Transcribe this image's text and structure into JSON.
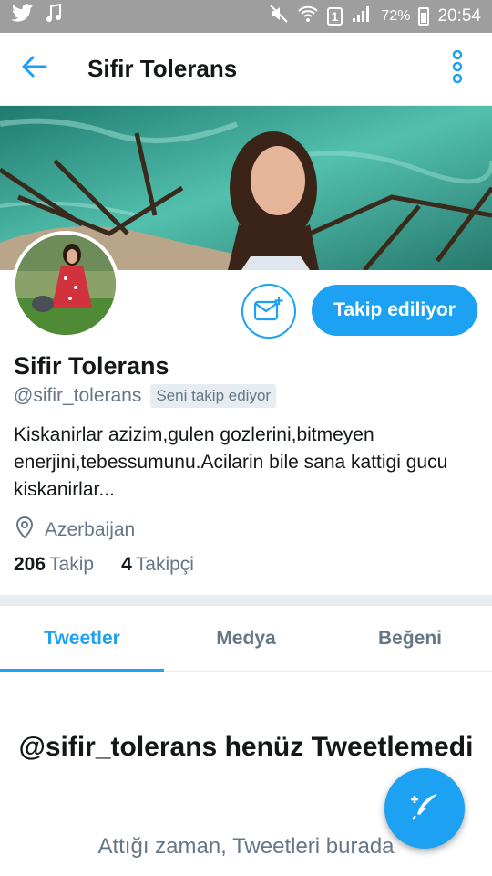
{
  "status_bar": {
    "icons_left": [
      "twitter-icon",
      "music-note-icon"
    ],
    "icons_right": [
      "mute-icon",
      "wifi-icon",
      "sim-icon",
      "signal-icon",
      "battery-icon"
    ],
    "sim_label": "1",
    "battery": "72%",
    "time": "20:54"
  },
  "app_bar": {
    "title": "Sifir Tolerans",
    "back_icon": "arrow-left-icon",
    "more_icon": "more-vertical-icon"
  },
  "profile": {
    "name": "Sifir Tolerans",
    "handle": "@sifir_tolerans",
    "follows_you_badge": "Seni takip ediyor",
    "bio": "Kiskanirlar azizim,gulen gozlerini,bitmeyen enerjini,tebessumunu.Acilarin bile sana kattigi gucu kiskanirlar...",
    "location": "Azerbaijan",
    "following_count": "206",
    "following_label": "Takip",
    "followers_count": "4",
    "followers_label": "Takipçi"
  },
  "actions": {
    "message_icon": "mail-plus-icon",
    "follow_label": "Takip ediliyor"
  },
  "tabs": [
    {
      "label": "Tweetler",
      "active": true
    },
    {
      "label": "Medya",
      "active": false
    },
    {
      "label": "Beğeni",
      "active": false
    }
  ],
  "empty_state": {
    "title": "@sifir_tolerans henüz Tweetlemedi",
    "subtitle": "Attığı zaman, Tweetleri burada"
  },
  "fab_icon": "compose-tweet-icon",
  "colors": {
    "accent": "#1da1f2",
    "secondary_text": "#657786",
    "status_bar": "#9e9e9e"
  }
}
